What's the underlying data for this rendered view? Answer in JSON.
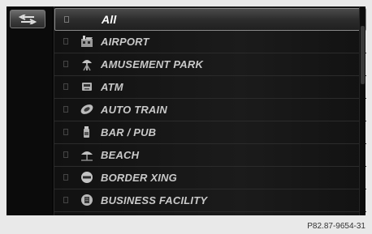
{
  "back_button": {
    "icon": "back-arrow-icon"
  },
  "list": {
    "items": [
      {
        "label": "All",
        "icon": "none",
        "selected": true
      },
      {
        "label": "AIRPORT",
        "icon": "airport-icon"
      },
      {
        "label": "AMUSEMENT PARK",
        "icon": "amusement-park-icon"
      },
      {
        "label": "ATM",
        "icon": "atm-icon"
      },
      {
        "label": "AUTO TRAIN",
        "icon": "auto-train-icon"
      },
      {
        "label": "BAR / PUB",
        "icon": "bar-pub-icon"
      },
      {
        "label": "BEACH",
        "icon": "beach-icon"
      },
      {
        "label": "BORDER XING",
        "icon": "border-crossing-icon"
      },
      {
        "label": "BUSINESS FACILITY",
        "icon": "business-facility-icon"
      }
    ]
  },
  "caption": "P82.87-9654-31",
  "colors": {
    "background": "#070707",
    "text": "#c9c9c9",
    "selected_text": "#ffffff"
  }
}
